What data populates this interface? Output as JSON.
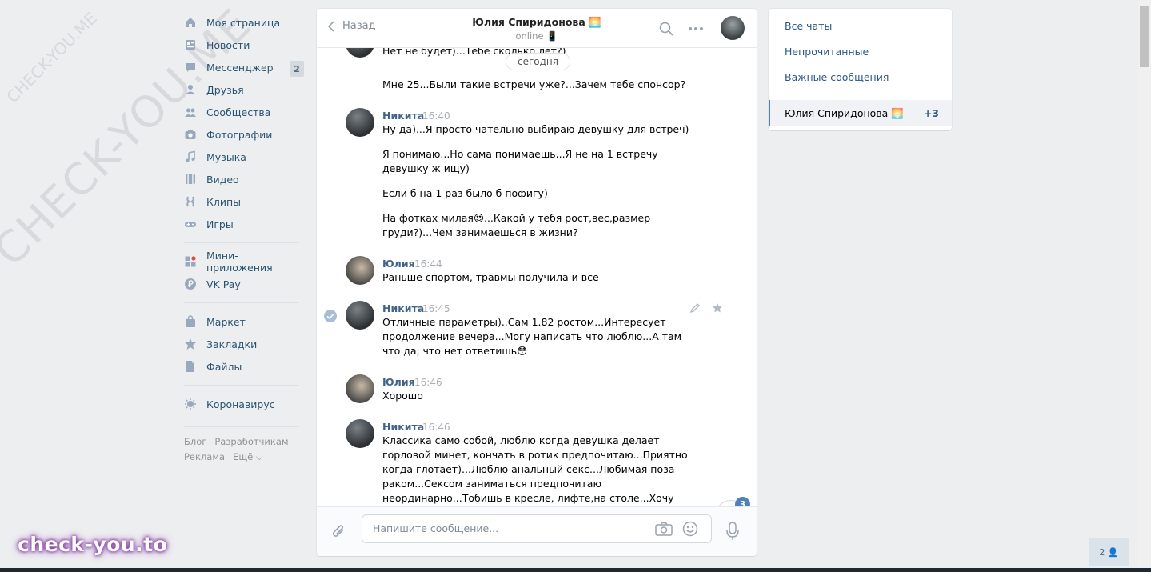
{
  "watermark": {
    "diagonal_large": "CHECK-YOU.ME",
    "diagonal_small": "CHECK-YOU.ME",
    "bottom": "check-you.to"
  },
  "nav": {
    "items": [
      {
        "label": "Моя страница",
        "icon": "home-icon"
      },
      {
        "label": "Новости",
        "icon": "news-icon"
      },
      {
        "label": "Мессенджер",
        "icon": "messenger-icon",
        "badge": "2"
      },
      {
        "label": "Друзья",
        "icon": "friends-icon"
      },
      {
        "label": "Сообщества",
        "icon": "communities-icon"
      },
      {
        "label": "Фотографии",
        "icon": "photos-icon"
      },
      {
        "label": "Музыка",
        "icon": "music-icon"
      },
      {
        "label": "Видео",
        "icon": "video-icon"
      },
      {
        "label": "Клипы",
        "icon": "clips-icon"
      },
      {
        "label": "Игры",
        "icon": "games-icon"
      }
    ],
    "items2": [
      {
        "label": "Мини-приложения",
        "icon": "mini-apps-icon"
      },
      {
        "label": "VK Pay",
        "icon": "vkpay-icon"
      }
    ],
    "items3": [
      {
        "label": "Маркет",
        "icon": "market-icon"
      },
      {
        "label": "Закладки",
        "icon": "bookmarks-icon"
      },
      {
        "label": "Файлы",
        "icon": "files-icon"
      }
    ],
    "items4": [
      {
        "label": "Коронавирус",
        "icon": "coronavirus-icon"
      }
    ],
    "footer": {
      "blog": "Блог",
      "dev": "Разработчикам",
      "ads": "Реклама",
      "more": "Ещё ⌵"
    }
  },
  "chat": {
    "back": "Назад",
    "contact_name": "Юлия Спиридонова 🌅",
    "status": "online 📱",
    "date_pill": "сегодня",
    "messages": [
      {
        "text": "Нет не будет)...Тебе сколько лет?)"
      },
      {
        "text": "Мне 25...Были такие встречи уже?...Зачем тебе спонсор?"
      },
      {
        "author": "Никита",
        "time": "16:40",
        "text": "Ну да)...Я просто чательно выбираю девушку для встреч)"
      },
      {
        "text": "Я понимаю...Но сама понимаешь...Я не на 1 встречу девушку ж ищу)"
      },
      {
        "text": "Если б на 1 раз было б пофигу)"
      },
      {
        "text": "На фотках милая😍...Какой у тебя рост,вес,размер груди?)...Чем занимаешься в жизни?"
      },
      {
        "author": "Юлия",
        "time": "16:44",
        "text": "Раньше спортом, травмы получила и все"
      },
      {
        "author": "Никита",
        "time": "16:45",
        "text": "Отличные параметры)..Сам 1.82 ростом...Интересует продолжение вечера...Могу написать что люблю...А там что да, что нет ответишь😳"
      },
      {
        "author": "Юлия",
        "time": "16:46",
        "text": "Хорошо"
      },
      {
        "author": "Никита",
        "time": "16:46",
        "text": "Классика само собой, люблю когда девушка делает горловой минет, кончать в ротик предпочитаю...Приятно когда глотает)...Люблю анальный секс...Любимая поза раком...Сексом заниматься предпочитаю неординарно...Тобишь в кресле, лифте,на столе...Хочу попробовать на пляже)...Но это не означает что на кровати им"
      }
    ],
    "unread_badge": "3",
    "input_placeholder": "Напишите сообщение..."
  },
  "right_panel": {
    "all_chats": "Все чаты",
    "unread": "Непрочитанные",
    "important": "Важные сообщения",
    "active_chat": {
      "name": "Юлия Спиридонова 🌅",
      "count": "+3"
    }
  },
  "online_counter": "2 👤",
  "colors": {
    "accent": "#5181b8",
    "link": "#2a5885",
    "bg": "#edeef0",
    "name": "#42648b"
  }
}
